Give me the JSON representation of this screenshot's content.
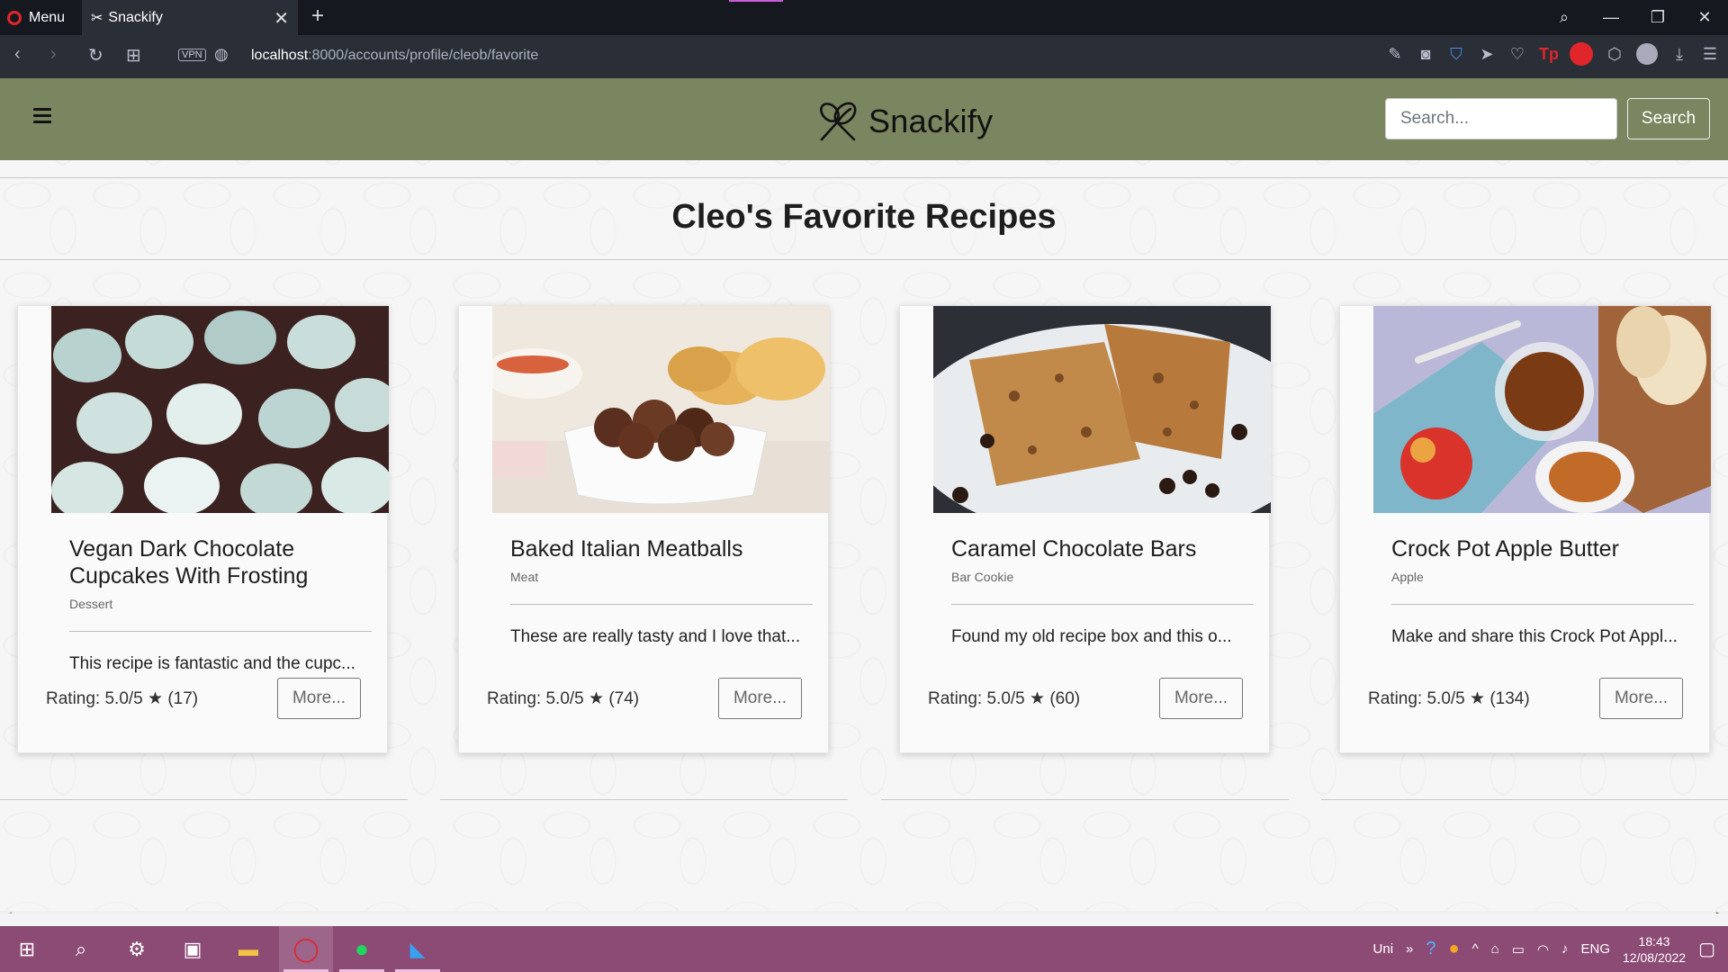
{
  "browser": {
    "menu_label": "Menu",
    "tab_title": "Snackify",
    "vpn_label": "VPN",
    "url_host": "localhost",
    "url_path": ":8000/accounts/profile/cleob/favorite"
  },
  "site": {
    "brand": "Snackify",
    "search_placeholder": "Search...",
    "search_button": "Search",
    "nav_color": "#7a8660"
  },
  "page_title": "Cleo's Favorite Recipes",
  "cards": [
    {
      "title_line1": "Vegan Dark Chocolate",
      "title_line2": "Cupcakes With Frosting",
      "category": "Dessert",
      "description": "This recipe is fantastic and the cupc...",
      "rating": "Rating: 5.0/5 ★ (17)",
      "more": "More..."
    },
    {
      "title_line1": "Baked Italian Meatballs",
      "title_line2": "",
      "category": "Meat",
      "description": "These are really tasty and I love that...",
      "rating": "Rating: 5.0/5 ★ (74)",
      "more": "More..."
    },
    {
      "title_line1": "Caramel Chocolate Bars",
      "title_line2": "",
      "category": "Bar Cookie",
      "description": "Found my old recipe box and this o...",
      "rating": "Rating: 5.0/5 ★ (60)",
      "more": "More..."
    },
    {
      "title_line1": "Crock Pot Apple Butter",
      "title_line2": "",
      "category": "Apple",
      "description": "Make and share this Crock Pot Appl...",
      "rating": "Rating: 5.0/5 ★ (134)",
      "more": "More..."
    }
  ],
  "taskbar": {
    "tray_text": "Uni",
    "language": "ENG",
    "time": "18:43",
    "date": "12/08/2022"
  }
}
